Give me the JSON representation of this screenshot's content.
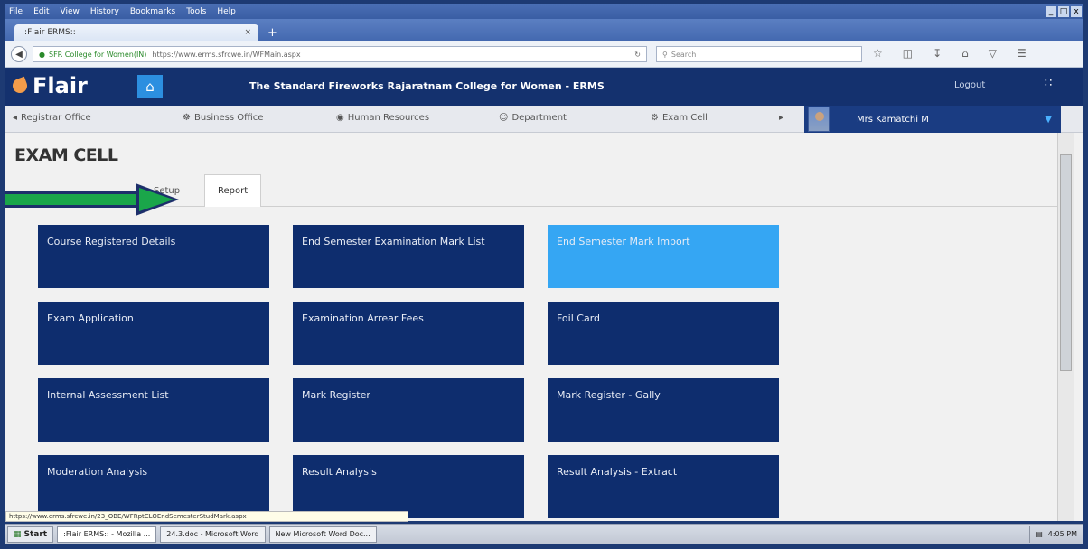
{
  "browser": {
    "menu": [
      "File",
      "Edit",
      "View",
      "History",
      "Bookmarks",
      "Tools",
      "Help"
    ],
    "window_buttons": [
      "_",
      "□",
      "x"
    ],
    "tab_title": "::Flair ERMS::",
    "tab_close": "×",
    "new_tab": "+",
    "back": "◀",
    "url_site": "SFR College for Women(IN)",
    "url": "https://www.erms.sfrcwe.in/WFMain.aspx",
    "search_placeholder": "Search",
    "status_url": "https://www.erms.sfrcwe.in/23_OBE/WFRptCLOEndSemesterStudMark.aspx"
  },
  "header": {
    "brand": "Flair",
    "college": "The Standard Fireworks Rajaratnam College for Women - ERMS",
    "logout": "Logout"
  },
  "nav": {
    "items": [
      "Registrar Office",
      "Business Office",
      "Human Resources",
      "Department",
      "Exam Cell"
    ],
    "user": "Mrs Kamatchi M"
  },
  "page": {
    "title": "EXAM CELL",
    "tabs": [
      "Setup",
      "Report"
    ],
    "active_tab": "Report"
  },
  "tiles": [
    {
      "label": "Course Registered Details",
      "highlight": false
    },
    {
      "label": "End Semester Examination Mark List",
      "highlight": false
    },
    {
      "label": "End Semester Mark Import",
      "highlight": true
    },
    {
      "label": "Exam Application",
      "highlight": false
    },
    {
      "label": "Examination Arrear Fees",
      "highlight": false
    },
    {
      "label": "Foil Card",
      "highlight": false
    },
    {
      "label": "Internal Assessment List",
      "highlight": false
    },
    {
      "label": "Mark Register",
      "highlight": false
    },
    {
      "label": "Mark Register - Gally",
      "highlight": false
    },
    {
      "label": "Moderation Analysis",
      "highlight": false
    },
    {
      "label": "Result Analysis",
      "highlight": false
    },
    {
      "label": "Result Analysis - Extract",
      "highlight": false
    }
  ],
  "taskbar": {
    "start": "Start",
    "items": [
      ":Flair ERMS:: - Mozilla ...",
      "24.3.doc - Microsoft Word",
      "New Microsoft Word Doc..."
    ],
    "time": "4:05 PM"
  },
  "colors": {
    "tile": "#0e2d6e",
    "tile_highlight": "#35a6f3",
    "header": "#14316e",
    "arrow": "#1aa64a"
  }
}
